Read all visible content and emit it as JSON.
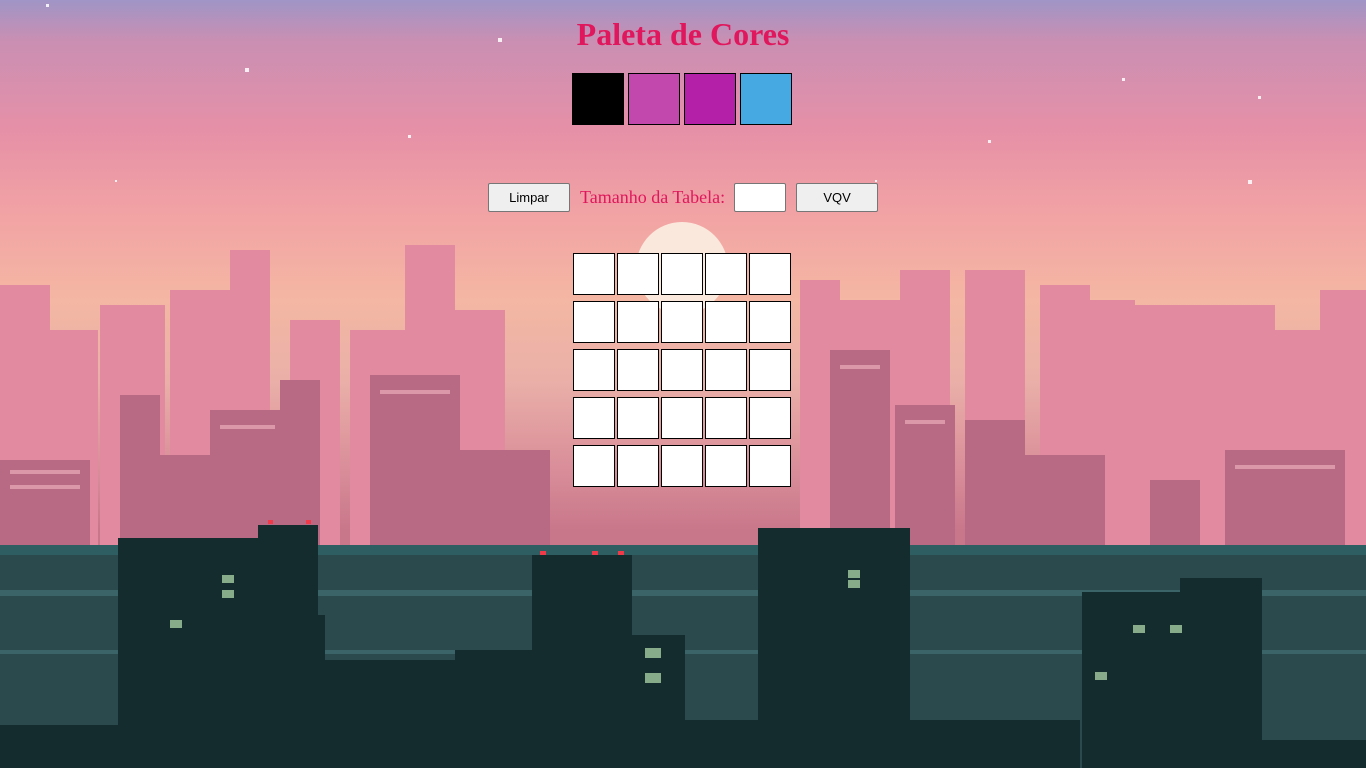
{
  "app": {
    "title": "Paleta de Cores"
  },
  "palette": {
    "colors": [
      "#000000",
      "#c248ad",
      "#b421a8",
      "#46a9e1"
    ],
    "selected_index": 0
  },
  "controls": {
    "clear_label": "Limpar",
    "size_label": "Tamanho da Tabela:",
    "size_value": "",
    "generate_label": "VQV"
  },
  "board": {
    "rows": 5,
    "cols": 5,
    "cell_color": "#ffffff"
  },
  "colors": {
    "accent": "#e0175c",
    "sky_top": "#9f95c6",
    "sky_bottom": "#f4b7a3",
    "city_dark": "#152c2f"
  },
  "background": {
    "description_icon": "pixel-city-skyline-icon"
  }
}
